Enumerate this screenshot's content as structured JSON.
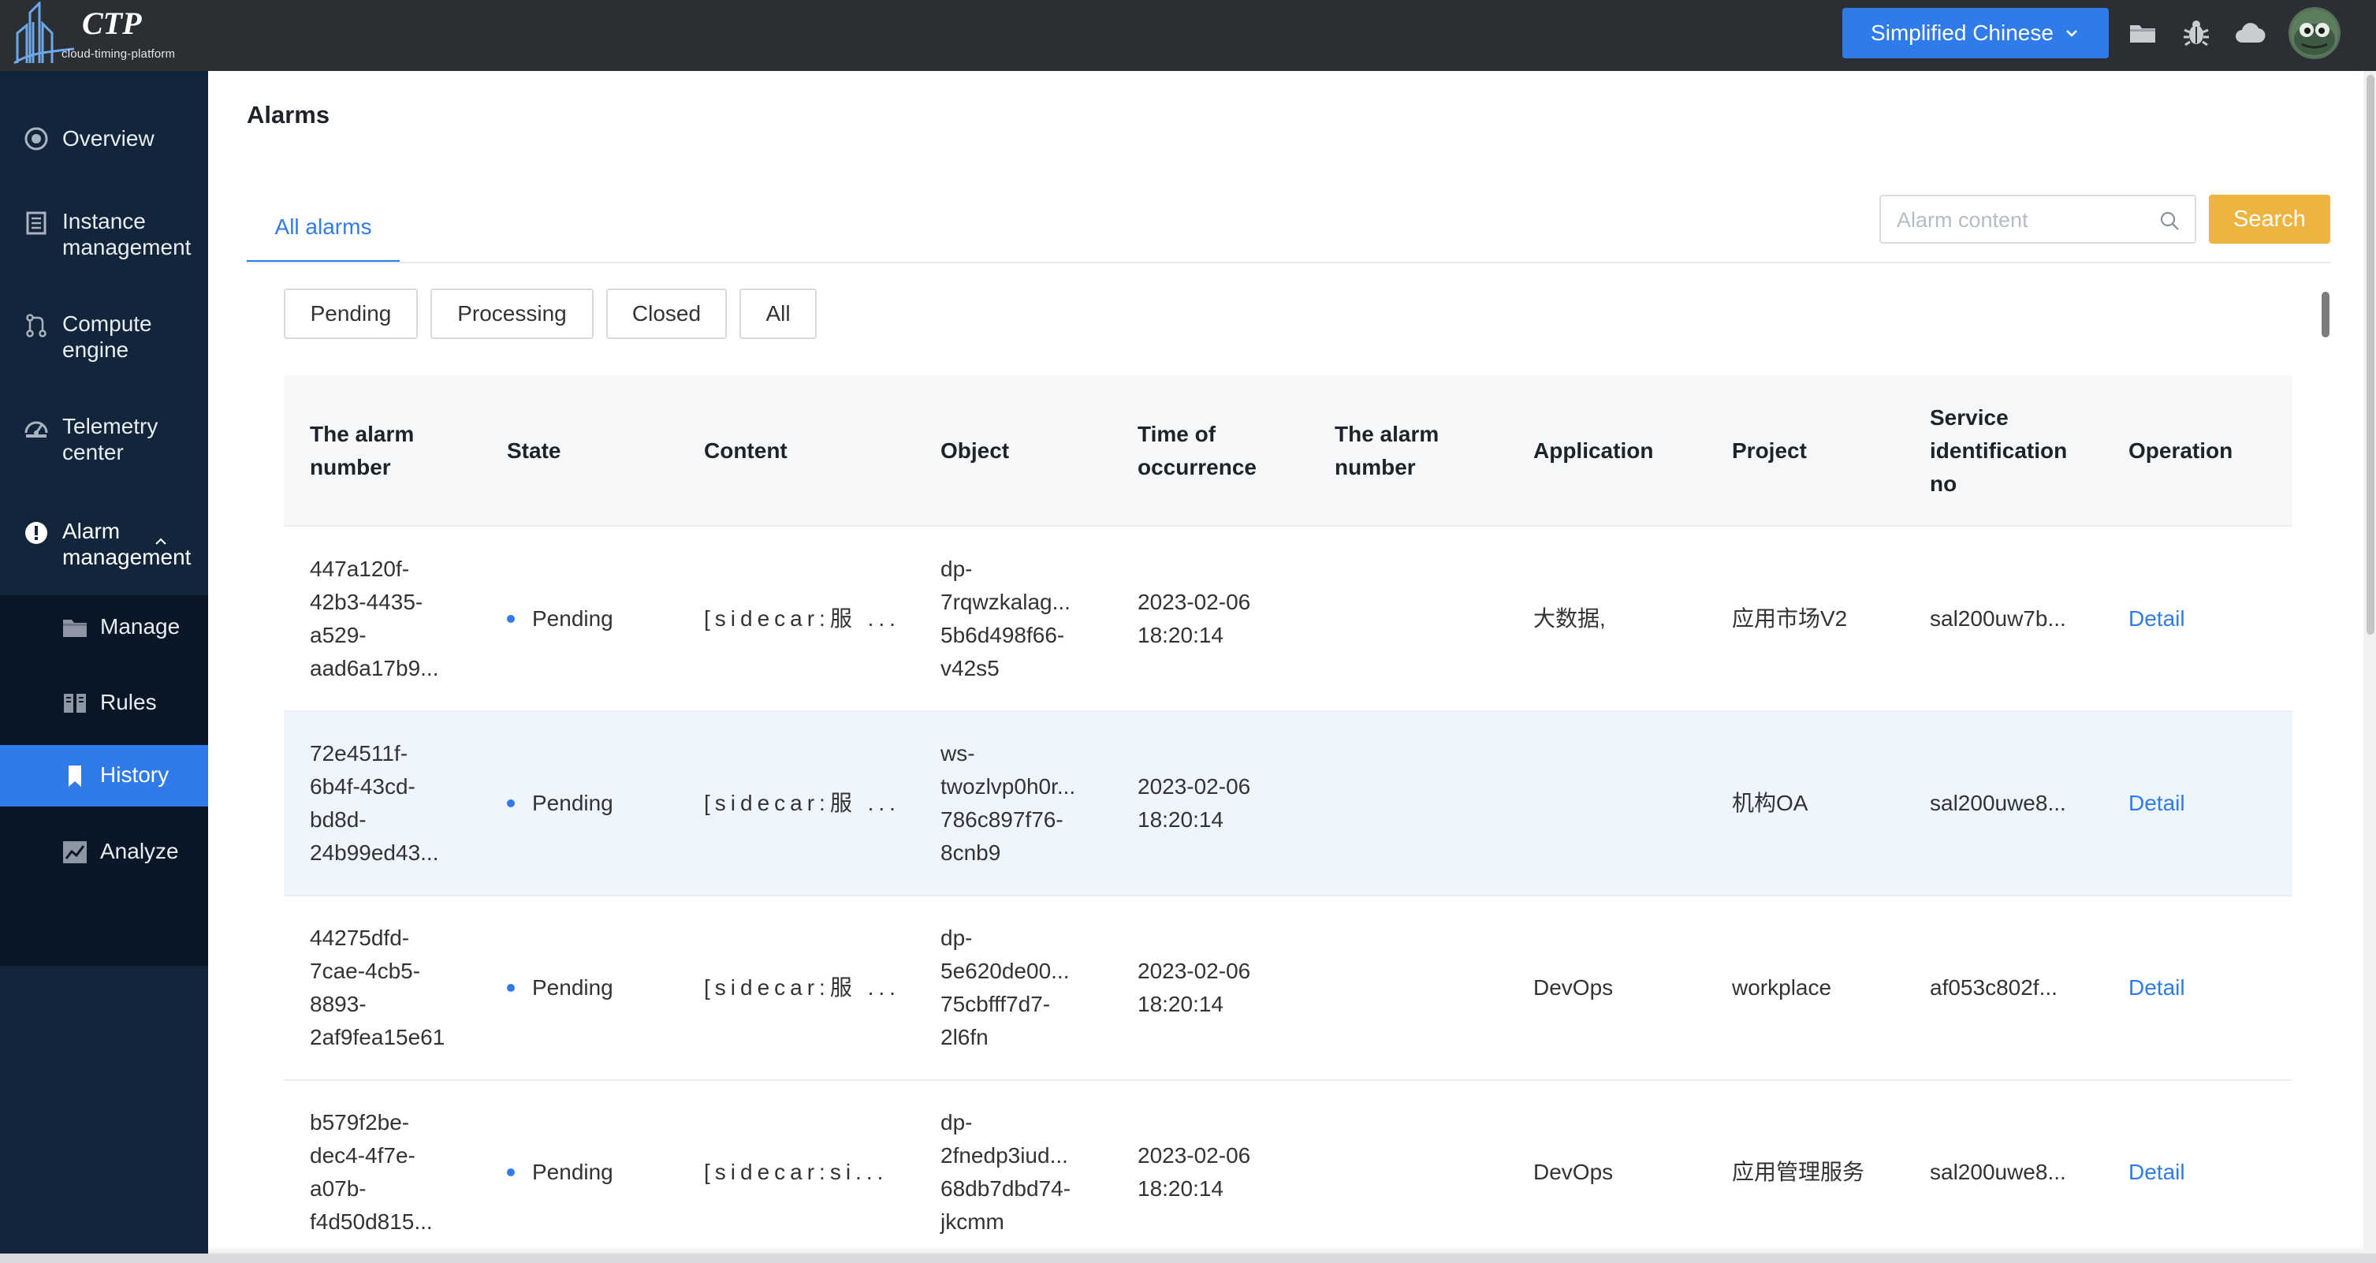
{
  "brand": {
    "title": "CTP",
    "subtitle": "cloud-timing-platform"
  },
  "topbar": {
    "language": "Simplified Chinese",
    "icons": [
      "folder-icon",
      "bug-icon",
      "cloud-icon"
    ]
  },
  "sidebar": {
    "items": [
      {
        "label": "Overview",
        "icon": "overview-icon"
      },
      {
        "label": "Instance management",
        "icon": "instance-icon"
      },
      {
        "label": "Compute engine",
        "icon": "compute-icon"
      },
      {
        "label": "Telemetry center",
        "icon": "telemetry-icon"
      },
      {
        "label": "Alarm management",
        "icon": "alarm-icon"
      }
    ],
    "subitems": [
      {
        "label": "Manage",
        "icon": "folder-icon"
      },
      {
        "label": "Rules",
        "icon": "book-icon"
      },
      {
        "label": "History",
        "icon": "bookmark-icon",
        "active": true
      },
      {
        "label": "Analyze",
        "icon": "chart-icon"
      }
    ]
  },
  "page": {
    "title": "Alarms",
    "tab": "All alarms"
  },
  "search": {
    "placeholder": "Alarm content",
    "value": "",
    "button": "Search"
  },
  "filters": [
    "Pending",
    "Processing",
    "Closed",
    "All"
  ],
  "table": {
    "columns": [
      "The alarm number",
      "State",
      "Content",
      "Object",
      "Time of occurrence",
      "The alarm number",
      "Application",
      "Project",
      "Service identification no",
      "Operation"
    ],
    "rows": [
      {
        "alarm_number_lines": [
          "447a120f-",
          "42b3-4435-",
          "a529-",
          "aad6a17b9..."
        ],
        "state": "Pending",
        "content": "[sidecar:服 ...",
        "object_lines": [
          "dp-",
          "7rqwzkalag...",
          "5b6d498f66-",
          "v42s5"
        ],
        "time_lines": [
          "2023-02-06",
          "18:20:14"
        ],
        "alarm_number_2": "",
        "application": "大数据,",
        "project": "应用市场V2",
        "service_no": "sal200uw7b...",
        "operation": "Detail"
      },
      {
        "alarm_number_lines": [
          "72e4511f-",
          "6b4f-43cd-",
          "bd8d-",
          "24b99ed43..."
        ],
        "state": "Pending",
        "content": "[sidecar:服 ...",
        "object_lines": [
          "ws-",
          "twozlvp0h0r...",
          "786c897f76-",
          "8cnb9"
        ],
        "time_lines": [
          "2023-02-06",
          "18:20:14"
        ],
        "alarm_number_2": "",
        "application": "",
        "project": "机构OA",
        "service_no": "sal200uwe8...",
        "operation": "Detail"
      },
      {
        "alarm_number_lines": [
          "44275dfd-",
          "7cae-4cb5-",
          "8893-",
          "2af9fea15e61"
        ],
        "state": "Pending",
        "content": "[sidecar:服 ...",
        "object_lines": [
          "dp-",
          "5e620de00...",
          "75cbfff7d7-",
          "2l6fn"
        ],
        "time_lines": [
          "2023-02-06",
          "18:20:14"
        ],
        "alarm_number_2": "",
        "application": "DevOps",
        "project": "workplace",
        "service_no": "af053c802f...",
        "operation": "Detail"
      },
      {
        "alarm_number_lines": [
          "b579f2be-",
          "dec4-4f7e-",
          "a07b-",
          "f4d50d815..."
        ],
        "state": "Pending",
        "content": "[sidecar:si...",
        "object_lines": [
          "dp-",
          "2fnedp3iud...",
          "68db7dbd74-",
          "jkcmm"
        ],
        "time_lines": [
          "2023-02-06",
          "18:20:14"
        ],
        "alarm_number_2": "",
        "application": "DevOps",
        "project": "应用管理服务",
        "service_no": "sal200uwe8...",
        "operation": "Detail"
      }
    ]
  }
}
